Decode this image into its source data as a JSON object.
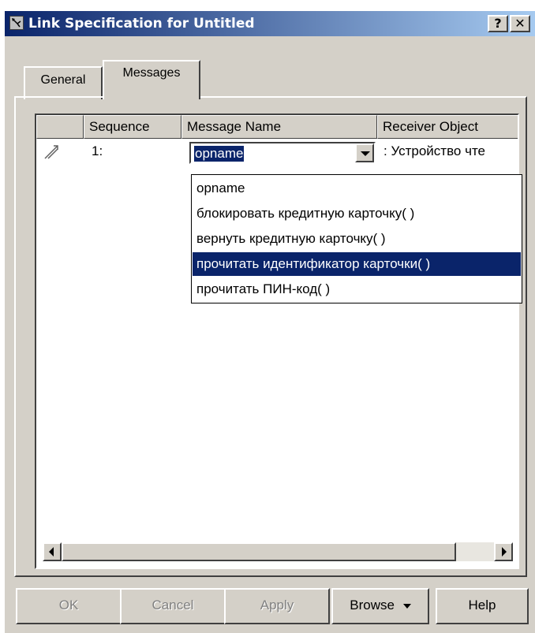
{
  "window": {
    "title": "Link Specification for Untitled",
    "help_glyph": "?",
    "close_glyph": "✕"
  },
  "tabs": [
    {
      "label": "General",
      "active": false
    },
    {
      "label": "Messages",
      "active": true
    }
  ],
  "grid": {
    "columns": [
      "",
      "Sequence",
      "Message Name",
      "Receiver Object"
    ],
    "rows": [
      {
        "icon": "message-link-icon",
        "sequence": "1:",
        "message_name": "opname",
        "receiver": ": Устройство чте"
      }
    ]
  },
  "combo": {
    "value": "opname"
  },
  "dropdown": {
    "items": [
      "opname",
      "блокировать кредитную карточку( )",
      "вернуть кредитную карточку( )",
      "прочитать идентификатор карточки( )",
      "прочитать ПИН-код( )"
    ],
    "selected_index": 3
  },
  "buttons": {
    "ok": "OK",
    "cancel": "Cancel",
    "apply": "Apply",
    "browse": "Browse",
    "help": "Help"
  },
  "colors": {
    "title_start": "#0a246a",
    "title_end": "#a6caf0",
    "face": "#d4d0c8",
    "selection": "#0a246a"
  }
}
